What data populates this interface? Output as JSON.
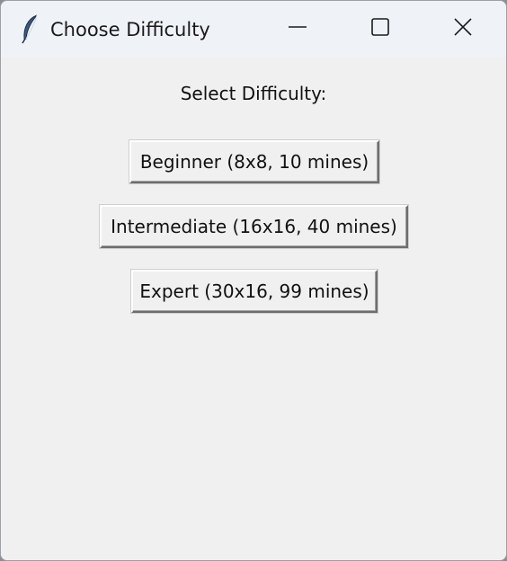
{
  "window": {
    "title": "Choose Difficulty",
    "app_icon": "feather-icon",
    "controls": {
      "minimize": "minimize-icon",
      "maximize": "maximize-icon",
      "close": "close-icon"
    }
  },
  "dialog": {
    "prompt": "Select Difficulty:",
    "buttons": [
      {
        "label": "Beginner (8x8, 10 mines)"
      },
      {
        "label": "Intermediate (16x16, 40 mines)"
      },
      {
        "label": "Expert (30x16, 99 mines)"
      }
    ]
  }
}
